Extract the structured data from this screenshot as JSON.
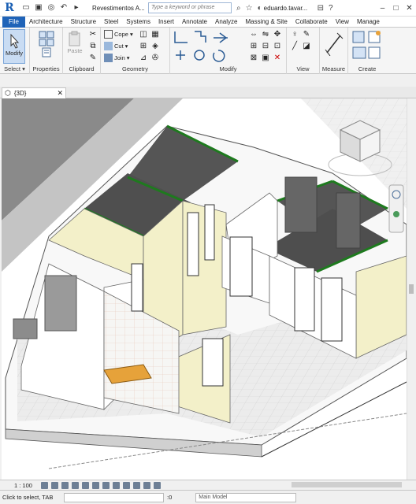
{
  "app": {
    "logo": "R",
    "document_title": "Revestimentos A...",
    "search_placeholder": "Type a keyword or phrase",
    "user": "eduardo.tavar...",
    "help": "?"
  },
  "ribbon_tabs": [
    "File",
    "Architecture",
    "Structure",
    "Steel",
    "Systems",
    "Insert",
    "Annotate",
    "Analyze",
    "Massing & Site",
    "Collaborate",
    "View",
    "Manage"
  ],
  "ribbon": {
    "select": {
      "modify_label": "Modify",
      "panel_label": "Select"
    },
    "properties": {
      "panel_label": "Properties"
    },
    "clipboard": {
      "paste_label": "Paste",
      "panel_label": "Clipboard"
    },
    "geometry": {
      "cope_label": "Cope",
      "cut_label": "Cut",
      "join_label": "Join",
      "panel_label": "Geometry"
    },
    "modify": {
      "panel_label": "Modify"
    },
    "view": {
      "panel_label": "View"
    },
    "measure": {
      "panel_label": "Measure"
    },
    "create": {
      "panel_label": "Create"
    }
  },
  "view_tab": {
    "label": "{3D}",
    "close": "✕"
  },
  "view_control": {
    "scale": "1 : 100"
  },
  "status": {
    "message": "Click to select, TAB",
    "zero": ":0",
    "model_selector": "Main Model"
  },
  "colors": {
    "accent": "#1f63b8",
    "wall_highlight": "#1e7a1e",
    "wall_face": "#f3f0c9",
    "floor": "#e6e6e6"
  }
}
